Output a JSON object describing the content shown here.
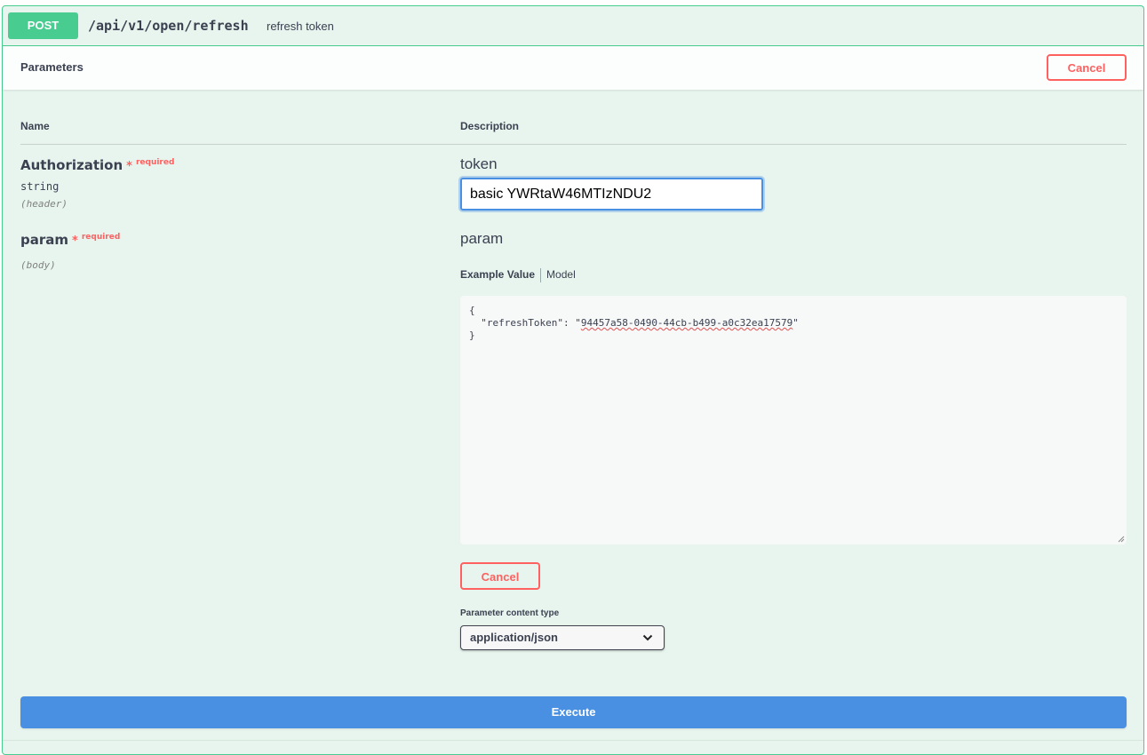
{
  "operation": {
    "method": "POST",
    "path": "/api/v1/open/refresh",
    "summary": "refresh token"
  },
  "parameters_section": {
    "title": "Parameters",
    "cancel_label": "Cancel"
  },
  "table": {
    "name_header": "Name",
    "description_header": "Description"
  },
  "params": [
    {
      "name": "Authorization",
      "required_star": "*",
      "required_text": "required",
      "type": "string",
      "in": "(header)",
      "description": "token",
      "value": "basic YWRtaW46MTIzNDU2"
    },
    {
      "name": "param",
      "required_star": "*",
      "required_text": "required",
      "in": "(body)",
      "description": "param"
    }
  ],
  "body": {
    "tab_example": "Example Value",
    "tab_model": "Model",
    "line1": "{",
    "line2_prefix": "  \"refreshToken\": \"",
    "line2_value": "94457a58-0490-44cb-b499-a0c32ea17579",
    "line2_suffix": "\"",
    "line3": "}",
    "cancel_label": "Cancel"
  },
  "content_type": {
    "label": "Parameter content type",
    "selected": "application/json"
  },
  "execute_label": "Execute",
  "colors": {
    "post_green": "#49cc90",
    "cancel_red": "#ff6060",
    "execute_blue": "#4990e2",
    "focus_blue": "#4a90e2"
  }
}
